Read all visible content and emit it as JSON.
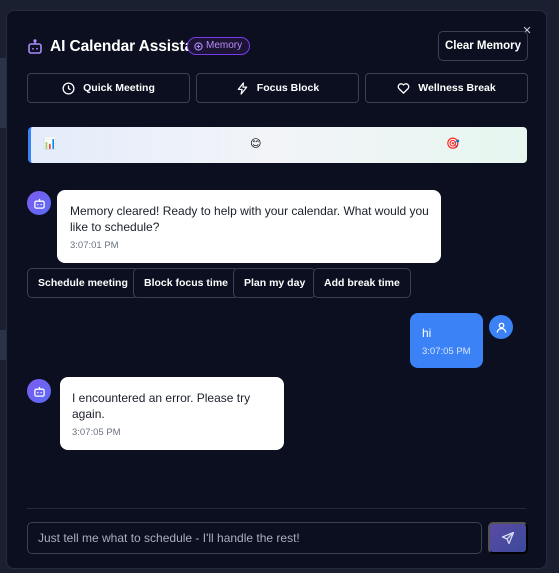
{
  "header": {
    "title": "AI Calendar Assistant",
    "memory_badge": "Memory",
    "clear_memory_label": "Clear Memory",
    "close_symbol": "×"
  },
  "quick_actions": [
    {
      "label": "Quick Meeting",
      "icon": "clock-icon"
    },
    {
      "label": "Focus Block",
      "icon": "lightning-icon"
    },
    {
      "label": "Wellness Break",
      "icon": "heart-icon"
    }
  ],
  "insights": [
    "📊",
    "😊",
    "🎯"
  ],
  "messages": [
    {
      "role": "assistant",
      "text": "Memory cleared! Ready to help with your calendar. What would you like to schedule?",
      "time": "3:07:01 PM"
    },
    {
      "role": "user",
      "text": "hi",
      "time": "3:07:05 PM"
    },
    {
      "role": "assistant",
      "text": "I encountered an error. Please try again.",
      "time": "3:07:05 PM"
    }
  ],
  "suggestions": [
    "Schedule meeting",
    "Block focus time",
    "Plan my day",
    "Add break time"
  ],
  "input": {
    "placeholder": "Just tell me what to schedule - I'll handle the rest!"
  },
  "colors": {
    "background": "#0b0f1f",
    "accent": "#3b82f6",
    "memory_badge": "#7c3aed"
  }
}
